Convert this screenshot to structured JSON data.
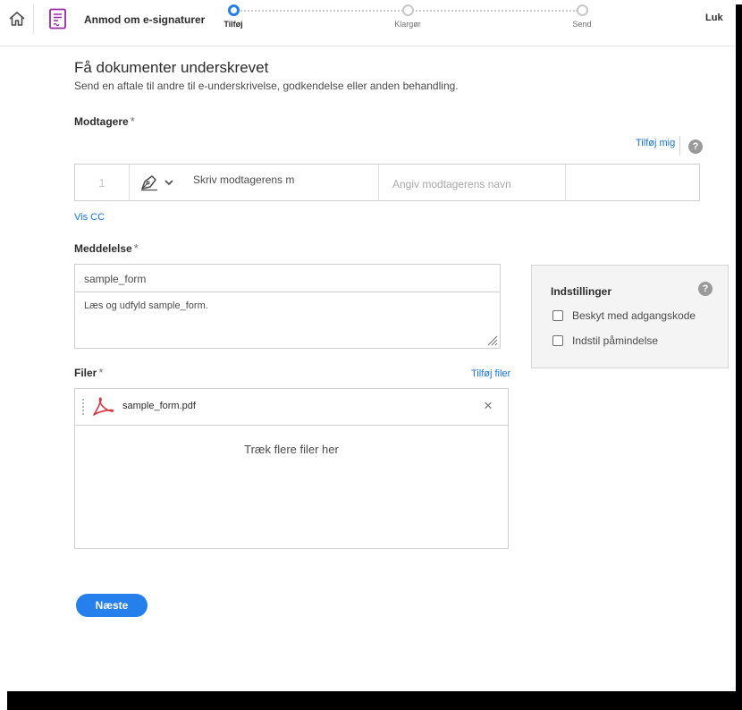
{
  "header": {
    "app_title": "Anmod om e-signaturer",
    "close_label": "Luk",
    "steps": [
      {
        "label": "Tilføj",
        "active": true
      },
      {
        "label": "Klargør",
        "active": false
      },
      {
        "label": "Send",
        "active": false
      }
    ]
  },
  "main": {
    "title": "Få dokumenter underskrevet",
    "subtitle": "Send en aftale til andre til e-underskrivelse, godkendelse eller anden behandling."
  },
  "recipients": {
    "label": "Modtagere",
    "required_mark": "*",
    "add_me_link": "Tilføj mig",
    "help": "?",
    "row": {
      "number": "1",
      "email_value": "Skriv modtagerens m",
      "name_placeholder": "Angiv modtagerens navn"
    },
    "show_cc": "Vis CC"
  },
  "message": {
    "label": "Meddelelse",
    "required_mark": "*",
    "subject": "sample_form",
    "body": "Læs og udfyld sample_form."
  },
  "settings": {
    "title": "Indstillinger",
    "help": "?",
    "options": [
      {
        "label": "Beskyt med adgangskode",
        "checked": false
      },
      {
        "label": "Indstil påmindelse",
        "checked": false
      }
    ]
  },
  "files": {
    "label": "Filer",
    "required_mark": "*",
    "add_files_link": "Tilføj filer",
    "items": [
      {
        "name": "sample_form.pdf"
      }
    ],
    "remove_icon": "×",
    "drop_text": "Træk flere filer her"
  },
  "actions": {
    "next_label": "Næste"
  },
  "colors": {
    "accent": "#2680eb",
    "link": "#1473e6",
    "app_icon": "#9b2aa6",
    "pdf_red": "#d7373f"
  }
}
